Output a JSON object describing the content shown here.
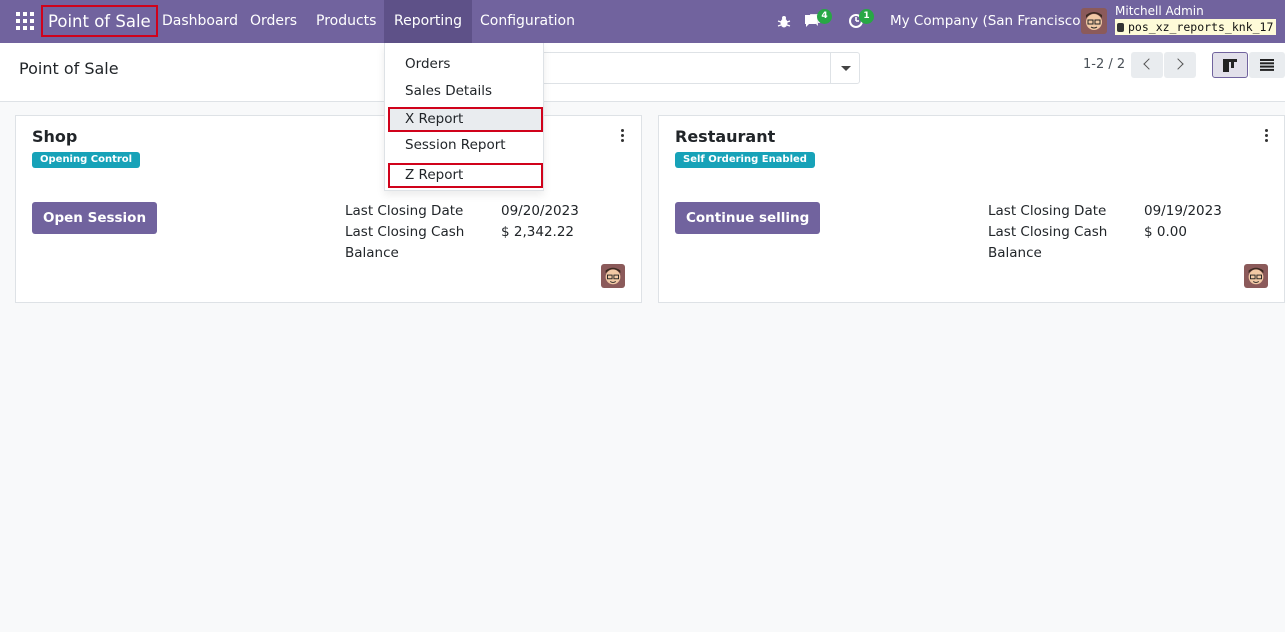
{
  "navbar": {
    "brand": "Point of Sale",
    "menu": [
      "Dashboard",
      "Orders",
      "Products",
      "Reporting",
      "Configuration"
    ],
    "messages_count": "4",
    "activities_count": "1",
    "company": "My Company (San Francisco)",
    "user_name": "Mitchell Admin",
    "database": "pos_xz_reports_knk_17"
  },
  "reporting_menu": {
    "items": [
      "Orders",
      "Sales Details",
      "X Report",
      "Session Report",
      "Z Report"
    ]
  },
  "control_panel": {
    "title": "Point of Sale",
    "pager": "1-2 / 2"
  },
  "cards": [
    {
      "title": "Shop",
      "badge": "Opening Control",
      "button": "Open Session",
      "last_closing_date_label": "Last Closing Date",
      "last_closing_date": "09/20/2023",
      "last_closing_cash_label": "Last Closing Cash",
      "last_closing_cash_label2": "Balance",
      "last_closing_cash": "$ 2,342.22"
    },
    {
      "title": "Restaurant",
      "badge": "Self Ordering Enabled",
      "button": "Continue selling",
      "last_closing_date_label": "Last Closing Date",
      "last_closing_date": "09/19/2023",
      "last_closing_cash_label": "Last Closing Cash",
      "last_closing_cash_label2": "Balance",
      "last_closing_cash": "$ 0.00"
    }
  ],
  "colors": {
    "navbar": "#71639e",
    "highlight": "#d0021b",
    "badge": "#17a2b8",
    "notification": "#28a745"
  }
}
